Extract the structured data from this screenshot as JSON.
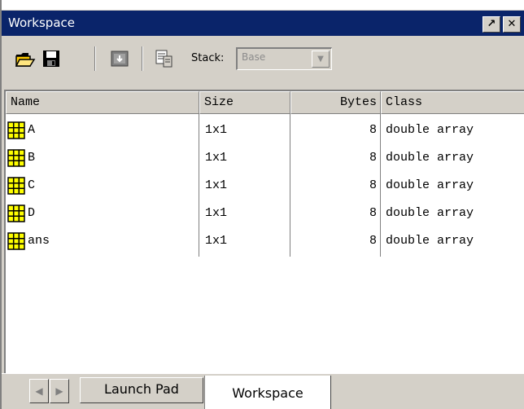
{
  "window": {
    "title": "Workspace",
    "undock_glyph": "↗",
    "close_glyph": "✕"
  },
  "toolbar": {
    "icons": [
      "open-folder-icon",
      "save-icon",
      "import-data-icon",
      "delete-icon"
    ],
    "stack_label": "Stack:",
    "stack_value": "Base",
    "stack_arrow": "▼"
  },
  "table": {
    "columns": [
      "Name",
      "Size",
      "Bytes",
      "Class"
    ],
    "rows": [
      {
        "name": "A",
        "size": "1x1",
        "bytes": "8",
        "class": "double array"
      },
      {
        "name": "B",
        "size": "1x1",
        "bytes": "8",
        "class": "double array"
      },
      {
        "name": "C",
        "size": "1x1",
        "bytes": "8",
        "class": "double array"
      },
      {
        "name": "D",
        "size": "1x1",
        "bytes": "8",
        "class": "double array"
      },
      {
        "name": "ans",
        "size": "1x1",
        "bytes": "8",
        "class": "double array"
      }
    ]
  },
  "tabs": {
    "prev_glyph": "◀",
    "next_glyph": "▶",
    "items": [
      "Launch Pad",
      "Workspace"
    ],
    "active": "Workspace"
  },
  "colors": {
    "titlebar": "#0a246a",
    "array_icon_fill": "#ffff00",
    "chrome": "#d4d0c8"
  }
}
